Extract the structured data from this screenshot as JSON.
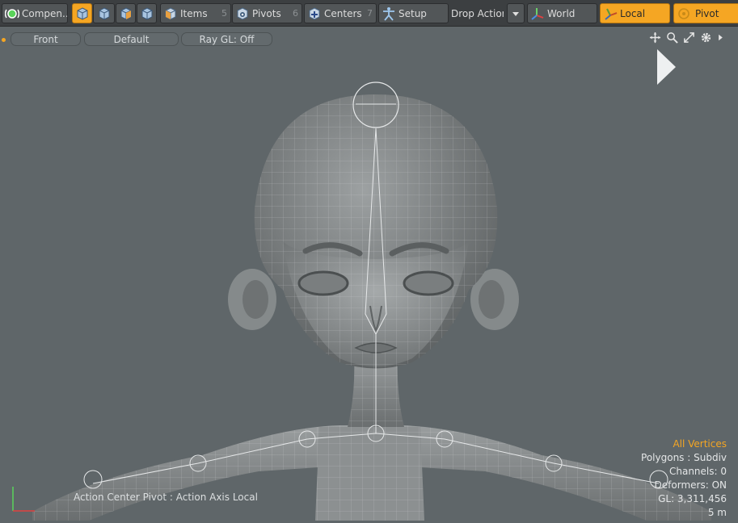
{
  "toolbar": {
    "compensate": {
      "label": "Compen..."
    },
    "items": {
      "label": "Items",
      "shortcut": "5"
    },
    "pivots": {
      "label": "Pivots",
      "shortcut": "6"
    },
    "centers": {
      "label": "Centers",
      "shortcut": "7"
    },
    "setup": {
      "label": "Setup"
    },
    "drop_action": {
      "label": "Drop Action"
    },
    "world": {
      "label": "World"
    },
    "local": {
      "label": "Local"
    },
    "pivot": {
      "label": "Pivot"
    }
  },
  "viewport_bar": {
    "view": "Front",
    "style": "Default",
    "raygl": "Ray GL: Off"
  },
  "viewport": {
    "action_center": "Action Center Pivot : Action Axis Local",
    "stats": {
      "selection": "All Vertices",
      "polygons": "Polygons : Subdiv",
      "channels": "Channels: 0",
      "deformers": "Deformers: ON",
      "gl": "GL: 3,311,456",
      "scale": "5 m"
    }
  },
  "colors": {
    "accent": "#f5a623",
    "viewport_bg": "#5f6669",
    "toolbar_bg": "#3c3f41"
  },
  "icons": [
    "compensate-icon",
    "mesh-cube-icon",
    "vertex-cube-icon",
    "edge-cube-icon",
    "polygon-cube-icon",
    "items-icon",
    "pivots-icon",
    "centers-icon",
    "setup-icon",
    "dropdown-arrow-icon",
    "world-axis-icon",
    "local-axis-icon",
    "pivot-target-icon",
    "move-view-icon",
    "zoom-icon",
    "maximize-icon",
    "gear-icon",
    "expand-arrow-icon",
    "play-arrow-icon",
    "axis-gizmo-icon"
  ]
}
